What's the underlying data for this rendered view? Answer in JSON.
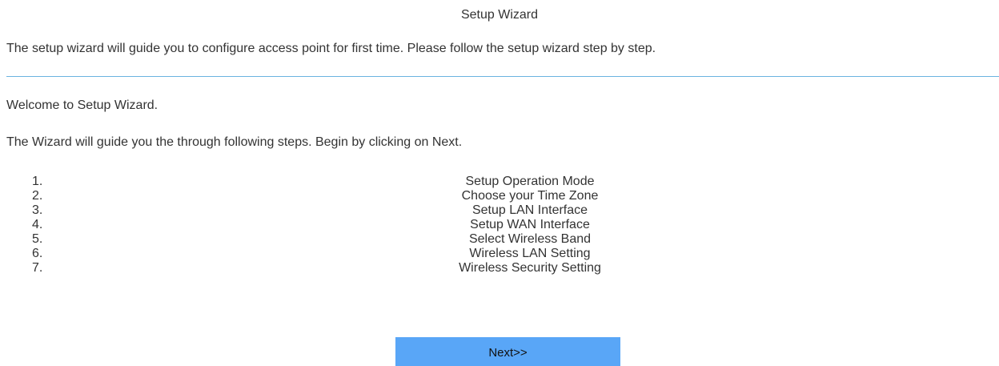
{
  "header": {
    "title": "Setup Wizard",
    "intro": "The setup wizard will guide you to configure access point for first time. Please follow the setup wizard step by step."
  },
  "main": {
    "welcome": "Welcome to Setup Wizard.",
    "guide": "The Wizard will guide you the through following steps. Begin by clicking on Next.",
    "steps": [
      {
        "num": "1.",
        "label": "Setup Operation Mode"
      },
      {
        "num": "2.",
        "label": "Choose your Time Zone"
      },
      {
        "num": "3.",
        "label": "Setup LAN Interface"
      },
      {
        "num": "4.",
        "label": "Setup WAN Interface"
      },
      {
        "num": "5.",
        "label": "Select Wireless Band"
      },
      {
        "num": "6.",
        "label": "Wireless LAN Setting"
      },
      {
        "num": "7.",
        "label": "Wireless Security Setting"
      }
    ],
    "next_label": "Next>>"
  },
  "colors": {
    "divider": "#6ab3e0",
    "button_bg": "#59a6f7",
    "text": "#333333"
  }
}
